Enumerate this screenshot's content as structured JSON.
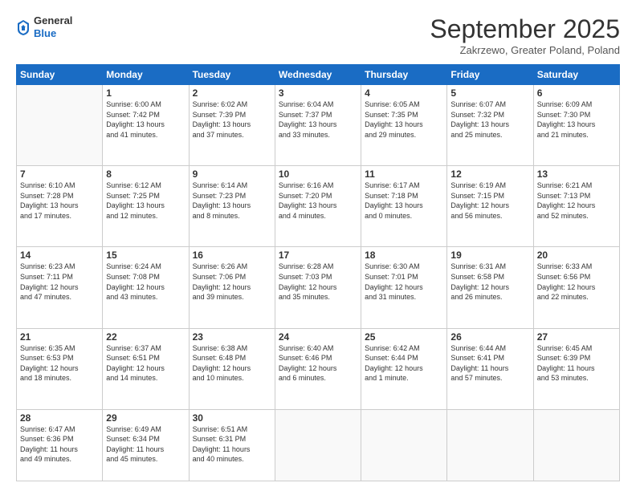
{
  "header": {
    "logo_general": "General",
    "logo_blue": "Blue",
    "month_title": "September 2025",
    "location": "Zakrzewo, Greater Poland, Poland"
  },
  "weekdays": [
    "Sunday",
    "Monday",
    "Tuesday",
    "Wednesday",
    "Thursday",
    "Friday",
    "Saturday"
  ],
  "weeks": [
    [
      {
        "day": "",
        "info": ""
      },
      {
        "day": "1",
        "info": "Sunrise: 6:00 AM\nSunset: 7:42 PM\nDaylight: 13 hours\nand 41 minutes."
      },
      {
        "day": "2",
        "info": "Sunrise: 6:02 AM\nSunset: 7:39 PM\nDaylight: 13 hours\nand 37 minutes."
      },
      {
        "day": "3",
        "info": "Sunrise: 6:04 AM\nSunset: 7:37 PM\nDaylight: 13 hours\nand 33 minutes."
      },
      {
        "day": "4",
        "info": "Sunrise: 6:05 AM\nSunset: 7:35 PM\nDaylight: 13 hours\nand 29 minutes."
      },
      {
        "day": "5",
        "info": "Sunrise: 6:07 AM\nSunset: 7:32 PM\nDaylight: 13 hours\nand 25 minutes."
      },
      {
        "day": "6",
        "info": "Sunrise: 6:09 AM\nSunset: 7:30 PM\nDaylight: 13 hours\nand 21 minutes."
      }
    ],
    [
      {
        "day": "7",
        "info": "Sunrise: 6:10 AM\nSunset: 7:28 PM\nDaylight: 13 hours\nand 17 minutes."
      },
      {
        "day": "8",
        "info": "Sunrise: 6:12 AM\nSunset: 7:25 PM\nDaylight: 13 hours\nand 12 minutes."
      },
      {
        "day": "9",
        "info": "Sunrise: 6:14 AM\nSunset: 7:23 PM\nDaylight: 13 hours\nand 8 minutes."
      },
      {
        "day": "10",
        "info": "Sunrise: 6:16 AM\nSunset: 7:20 PM\nDaylight: 13 hours\nand 4 minutes."
      },
      {
        "day": "11",
        "info": "Sunrise: 6:17 AM\nSunset: 7:18 PM\nDaylight: 13 hours\nand 0 minutes."
      },
      {
        "day": "12",
        "info": "Sunrise: 6:19 AM\nSunset: 7:15 PM\nDaylight: 12 hours\nand 56 minutes."
      },
      {
        "day": "13",
        "info": "Sunrise: 6:21 AM\nSunset: 7:13 PM\nDaylight: 12 hours\nand 52 minutes."
      }
    ],
    [
      {
        "day": "14",
        "info": "Sunrise: 6:23 AM\nSunset: 7:11 PM\nDaylight: 12 hours\nand 47 minutes."
      },
      {
        "day": "15",
        "info": "Sunrise: 6:24 AM\nSunset: 7:08 PM\nDaylight: 12 hours\nand 43 minutes."
      },
      {
        "day": "16",
        "info": "Sunrise: 6:26 AM\nSunset: 7:06 PM\nDaylight: 12 hours\nand 39 minutes."
      },
      {
        "day": "17",
        "info": "Sunrise: 6:28 AM\nSunset: 7:03 PM\nDaylight: 12 hours\nand 35 minutes."
      },
      {
        "day": "18",
        "info": "Sunrise: 6:30 AM\nSunset: 7:01 PM\nDaylight: 12 hours\nand 31 minutes."
      },
      {
        "day": "19",
        "info": "Sunrise: 6:31 AM\nSunset: 6:58 PM\nDaylight: 12 hours\nand 26 minutes."
      },
      {
        "day": "20",
        "info": "Sunrise: 6:33 AM\nSunset: 6:56 PM\nDaylight: 12 hours\nand 22 minutes."
      }
    ],
    [
      {
        "day": "21",
        "info": "Sunrise: 6:35 AM\nSunset: 6:53 PM\nDaylight: 12 hours\nand 18 minutes."
      },
      {
        "day": "22",
        "info": "Sunrise: 6:37 AM\nSunset: 6:51 PM\nDaylight: 12 hours\nand 14 minutes."
      },
      {
        "day": "23",
        "info": "Sunrise: 6:38 AM\nSunset: 6:48 PM\nDaylight: 12 hours\nand 10 minutes."
      },
      {
        "day": "24",
        "info": "Sunrise: 6:40 AM\nSunset: 6:46 PM\nDaylight: 12 hours\nand 6 minutes."
      },
      {
        "day": "25",
        "info": "Sunrise: 6:42 AM\nSunset: 6:44 PM\nDaylight: 12 hours\nand 1 minute."
      },
      {
        "day": "26",
        "info": "Sunrise: 6:44 AM\nSunset: 6:41 PM\nDaylight: 11 hours\nand 57 minutes."
      },
      {
        "day": "27",
        "info": "Sunrise: 6:45 AM\nSunset: 6:39 PM\nDaylight: 11 hours\nand 53 minutes."
      }
    ],
    [
      {
        "day": "28",
        "info": "Sunrise: 6:47 AM\nSunset: 6:36 PM\nDaylight: 11 hours\nand 49 minutes."
      },
      {
        "day": "29",
        "info": "Sunrise: 6:49 AM\nSunset: 6:34 PM\nDaylight: 11 hours\nand 45 minutes."
      },
      {
        "day": "30",
        "info": "Sunrise: 6:51 AM\nSunset: 6:31 PM\nDaylight: 11 hours\nand 40 minutes."
      },
      {
        "day": "",
        "info": ""
      },
      {
        "day": "",
        "info": ""
      },
      {
        "day": "",
        "info": ""
      },
      {
        "day": "",
        "info": ""
      }
    ]
  ]
}
